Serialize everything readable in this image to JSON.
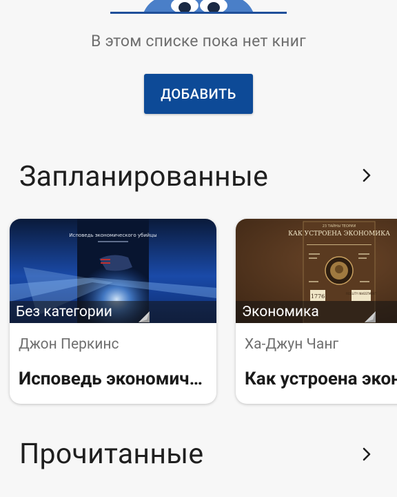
{
  "empty_state": {
    "message": "В этом списке пока нет книг",
    "add_button_label": "ДОБАВИТЬ"
  },
  "sections": [
    {
      "title": "Запланированные",
      "books": [
        {
          "category": "Без категории",
          "author": "Джон Перкинс",
          "title": "Исповедь экономического убийцы",
          "cover_title": "Исповедь экономического убийцы"
        },
        {
          "category": "Экономика",
          "author": "Ха-Джун Чанг",
          "title": "Как устроена экономика",
          "cover_title": "КАК УСТРОЕНА ЭКОНОМИКА",
          "cover_subtitle": "23 ТАЙНЫ ТЕОРИИ",
          "cover_badges": [
            "1776",
            "FIDELITY INVESTMENT"
          ]
        }
      ]
    },
    {
      "title": "Прочитанные"
    }
  ],
  "colors": {
    "accent": "#0d4a97",
    "background": "#f7f7f7",
    "mascot": "#4a7fc8"
  }
}
